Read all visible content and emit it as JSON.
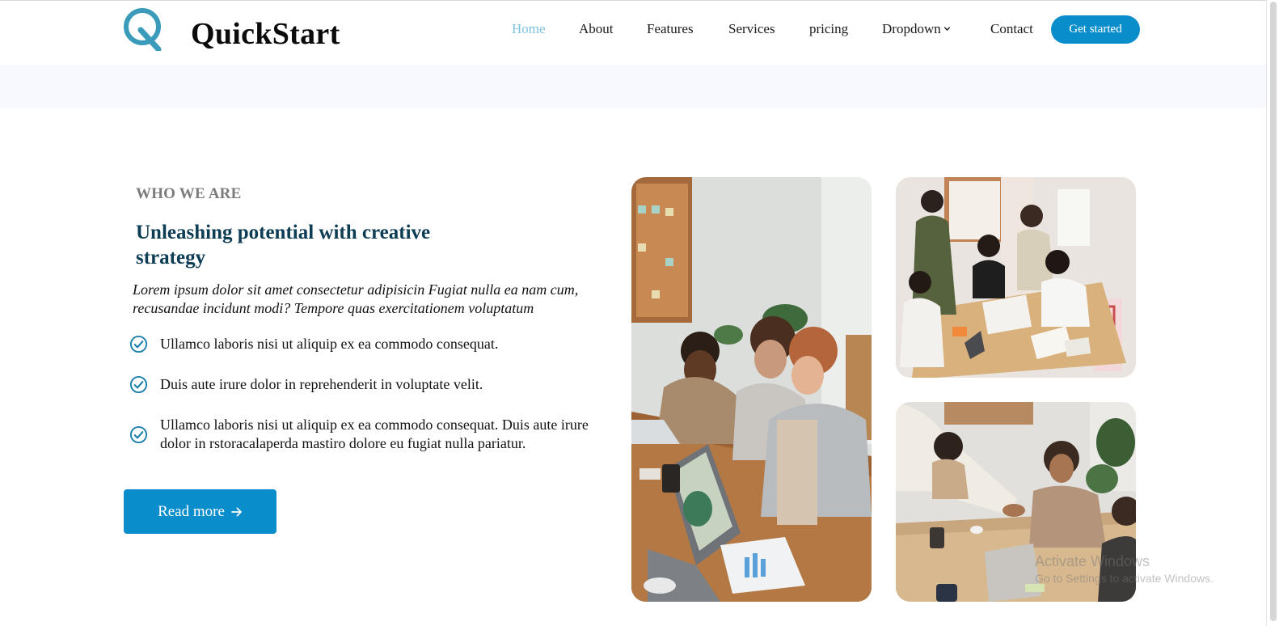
{
  "brand": {
    "name": "QuickStart",
    "logo_icon": "q-logo-icon",
    "accent": "#3b9bbb"
  },
  "nav": {
    "items": [
      {
        "label": "Home",
        "active": true
      },
      {
        "label": "About"
      },
      {
        "label": "Features"
      },
      {
        "label": "Services"
      },
      {
        "label": "pricing"
      },
      {
        "label": "Dropdown",
        "icon": "chevron-down-icon"
      },
      {
        "label": "Contact"
      }
    ],
    "cta_label": "Get started"
  },
  "about": {
    "eyebrow": "WHO WE ARE",
    "heading": "Unleashing potential with creative strategy",
    "intro": "Lorem ipsum dolor sit amet consectetur adipisicin Fugiat nulla ea nam cum, recusandae incidunt modi? Tempore quas exercitationem voluptatum",
    "checklist": [
      "Ullamco laboris nisi ut aliquip ex ea commodo consequat.",
      "Duis aute irure dolor in reprehenderit in voluptate velit.",
      "Ullamco laboris nisi ut aliquip ex ea commodo consequat. Duis aute irure dolor in rstoracalaperda mastiro dolore eu fugiat nulla pariatur."
    ],
    "check_icon": "check-circle-icon",
    "read_more_label": "Read more",
    "read_more_icon": "arrow-right-icon"
  },
  "gallery": {
    "images": [
      {
        "name": "team-meeting-laptops-photo"
      },
      {
        "name": "team-collaboration-table-photo"
      },
      {
        "name": "handshake-meeting-photo"
      }
    ]
  },
  "watermark": {
    "title": "Activate Windows",
    "subtitle": "Go to Settings to activate Windows."
  },
  "colors": {
    "primary": "#0a8ecb",
    "heading": "#0d3c55",
    "nav_active": "#7bc3de",
    "band": "#f8f9fe"
  }
}
